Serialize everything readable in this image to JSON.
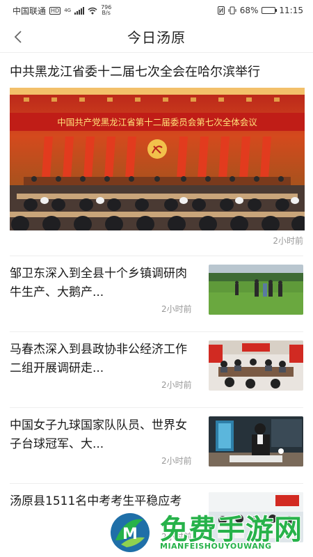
{
  "status_bar": {
    "carrier": "中国联通",
    "hd": "HD",
    "network": "4G",
    "speed_value": "796",
    "speed_unit": "B/s",
    "battery": "68%",
    "time": "11:15",
    "battery_level": 0.68
  },
  "nav": {
    "title": "今日汤原",
    "back_icon": "chevron-left-icon"
  },
  "headline": {
    "title": "中共黑龙江省委十二届七次全会在哈尔滨举行",
    "banner_text": "中国共产党黑龙江省第十二届委员会第七次全体会议",
    "time": "2小时前"
  },
  "news": [
    {
      "title": "邹卫东深入到全县十个乡镇调研肉牛生产、大鹅产...",
      "time": "2小时前"
    },
    {
      "title": "马春杰深入到县政协非公经济工作二组开展调研走...",
      "time": "2小时前"
    },
    {
      "title": "中国女子九球国家队队员、世界女子台球冠军、大...",
      "time": "2小时前"
    },
    {
      "title": "汤原县1511名中考考生平稳应考",
      "time": "2小时前"
    }
  ],
  "watermark": {
    "cn": "免费手游网",
    "en": "MIANFEISHOUYOUWANG"
  },
  "colors": {
    "accent_green": "#27b24a",
    "banner_red": "#c12a16",
    "muted_text": "#999999"
  }
}
